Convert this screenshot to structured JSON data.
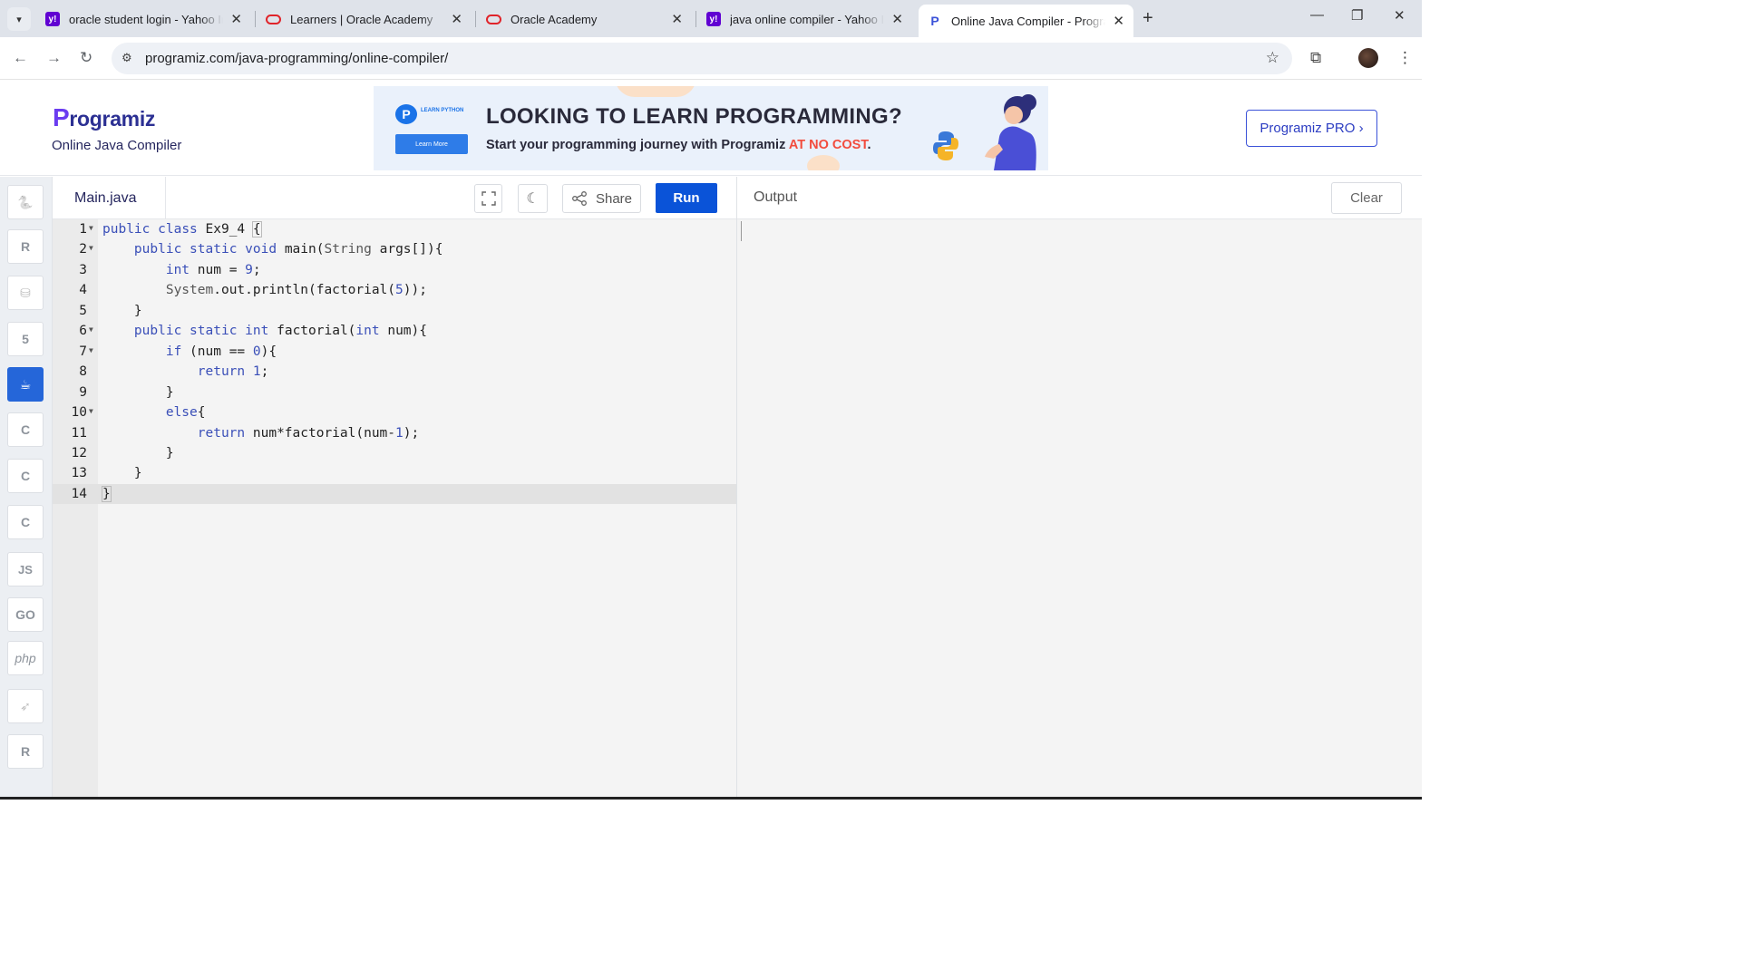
{
  "browser": {
    "tabs": [
      {
        "title": "oracle student login - Yahoo Inc",
        "favicon": "yahoo-icon",
        "active": false
      },
      {
        "title": "Learners | Oracle Academy",
        "favicon": "oracle-icon",
        "active": false
      },
      {
        "title": "Oracle Academy",
        "favicon": "oracle-icon",
        "active": false
      },
      {
        "title": "java online compiler - Yahoo Inc",
        "favicon": "yahoo-icon",
        "active": false
      },
      {
        "title": "Online Java Compiler - Programiz",
        "favicon": "programiz-icon",
        "active": true
      }
    ],
    "url": "programiz.com/java-programming/online-compiler/"
  },
  "header": {
    "logo_mark": "P",
    "logo_rest": "rogramiz",
    "subtitle": "Online Java Compiler",
    "pro_button": "Programiz PRO"
  },
  "banner": {
    "badge_text": "LEARN PYTHON",
    "button": "Learn More",
    "headline": "LOOKING TO LEARN PROGRAMMING?",
    "tagline": "Start your programming journey with Programiz ",
    "tagline_highlight": "AT NO COST",
    "tagline_end": "."
  },
  "sidebar": {
    "languages": [
      {
        "name": "python-icon",
        "label": "",
        "active": false
      },
      {
        "name": "r-icon",
        "label": "R",
        "active": false
      },
      {
        "name": "sql-icon",
        "label": "",
        "active": false
      },
      {
        "name": "html-icon",
        "label": "5",
        "active": false
      },
      {
        "name": "java-icon",
        "label": "",
        "active": true
      },
      {
        "name": "c-icon",
        "label": "C",
        "active": false
      },
      {
        "name": "cpp-icon",
        "label": "C",
        "active": false
      },
      {
        "name": "csharp-icon",
        "label": "C",
        "active": false
      },
      {
        "name": "js-icon",
        "label": "JS",
        "active": false
      },
      {
        "name": "go-icon",
        "label": "GO",
        "active": false
      },
      {
        "name": "php-icon",
        "label": "php",
        "active": false
      },
      {
        "name": "swift-icon",
        "label": "",
        "active": false
      },
      {
        "name": "rust-icon",
        "label": "R",
        "active": false
      }
    ]
  },
  "editor": {
    "filename": "Main.java",
    "share_label": "Share",
    "run_label": "Run",
    "current_line": 14,
    "lines": [
      {
        "n": "1",
        "fold": true,
        "html": "<span class='kw'>public</span> <span class='kw'>class</span> Ex9_4 <span class='bracket'>{</span>"
      },
      {
        "n": "2",
        "fold": true,
        "html": "    <span class='kw'>public</span> <span class='kw'>static</span> <span class='ty'>void</span> main(<span class='cls'>String</span> args[]){"
      },
      {
        "n": "3",
        "fold": false,
        "html": "        <span class='ty'>int</span> num = <span class='num'>9</span>;"
      },
      {
        "n": "4",
        "fold": false,
        "html": "        <span class='cls'>System</span>.out.println(factorial(<span class='num'>5</span>));"
      },
      {
        "n": "5",
        "fold": false,
        "html": "    }"
      },
      {
        "n": "6",
        "fold": true,
        "html": "    <span class='kw'>public</span> <span class='kw'>static</span> <span class='ty'>int</span> factorial(<span class='ty'>int</span> num){"
      },
      {
        "n": "7",
        "fold": true,
        "html": "        <span class='kw'>if</span> (num == <span class='num'>0</span>){"
      },
      {
        "n": "8",
        "fold": false,
        "html": "            <span class='kw'>return</span> <span class='num'>1</span>;"
      },
      {
        "n": "9",
        "fold": false,
        "html": "        }"
      },
      {
        "n": "10",
        "fold": true,
        "html": "        <span class='kw'>else</span>{"
      },
      {
        "n": "11",
        "fold": false,
        "html": "            <span class='kw'>return</span> num*factorial(num-<span class='num'>1</span>);"
      },
      {
        "n": "12",
        "fold": false,
        "html": "        }"
      },
      {
        "n": "13",
        "fold": false,
        "html": "    }"
      },
      {
        "n": "14",
        "fold": false,
        "html": "<span class='bracket'>}</span>"
      }
    ]
  },
  "output": {
    "title": "Output",
    "clear_label": "Clear",
    "content": ""
  },
  "colors": {
    "run": "#0a53d8",
    "active_language": "#2566d9",
    "brand": "#2c3093"
  }
}
